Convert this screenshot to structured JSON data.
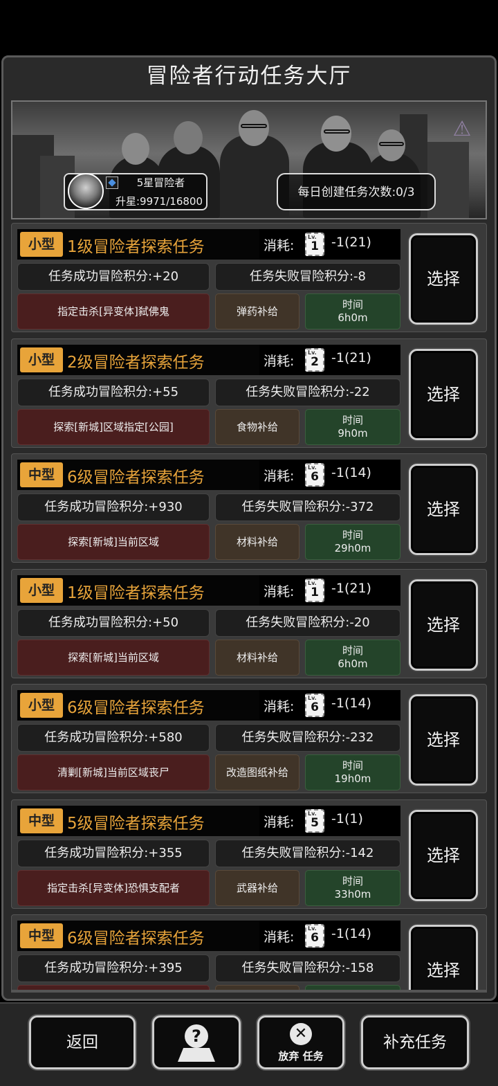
{
  "title": "冒险者行动任务大厅",
  "player": {
    "rank_label": "5星冒险者",
    "progress_label": "升星:9971/16800"
  },
  "daily": {
    "label": "每日创建任务次数:0/3"
  },
  "cost_label": "消耗:",
  "time_label": "时间",
  "select_label": "选择",
  "missions": [
    {
      "size": "小型",
      "title": "1级冒险者探索任务",
      "card_level": "1",
      "cost": "-1(21)",
      "success": "任务成功冒险积分:+20",
      "fail": "任务失败冒险积分:-8",
      "target": "指定击杀[异变体]弑佛鬼",
      "reward": "弹药补给",
      "time": "6h0m"
    },
    {
      "size": "小型",
      "title": "2级冒险者探索任务",
      "card_level": "2",
      "cost": "-1(21)",
      "success": "任务成功冒险积分:+55",
      "fail": "任务失败冒险积分:-22",
      "target": "探索[新城]区域指定[公园]",
      "reward": "食物补给",
      "time": "9h0m"
    },
    {
      "size": "中型",
      "title": "6级冒险者探索任务",
      "card_level": "6",
      "cost": "-1(14)",
      "success": "任务成功冒险积分:+930",
      "fail": "任务失败冒险积分:-372",
      "target": "探索[新城]当前区域",
      "reward": "材料补给",
      "time": "29h0m"
    },
    {
      "size": "小型",
      "title": "1级冒险者探索任务",
      "card_level": "1",
      "cost": "-1(21)",
      "success": "任务成功冒险积分:+50",
      "fail": "任务失败冒险积分:-20",
      "target": "探索[新城]当前区域",
      "reward": "材料补给",
      "time": "6h0m"
    },
    {
      "size": "小型",
      "title": "6级冒险者探索任务",
      "card_level": "6",
      "cost": "-1(14)",
      "success": "任务成功冒险积分:+580",
      "fail": "任务失败冒险积分:-232",
      "target": "清剿[新城]当前区域丧尸",
      "reward": "改造图纸补给",
      "time": "19h0m"
    },
    {
      "size": "中型",
      "title": "5级冒险者探索任务",
      "card_level": "5",
      "cost": "-1(1)",
      "success": "任务成功冒险积分:+355",
      "fail": "任务失败冒险积分:-142",
      "target": "指定击杀[异变体]恐惧支配者",
      "reward": "武器补给",
      "time": "33h0m"
    },
    {
      "size": "中型",
      "title": "6级冒险者探索任务",
      "card_level": "6",
      "cost": "-1(14)",
      "success": "任务成功冒险积分:+395",
      "fail": "任务失败冒险积分:-158",
      "target": "",
      "reward": "",
      "time": ""
    }
  ],
  "bottom": {
    "back_label": "返回",
    "help_icon": "question-map-icon",
    "abandon_label": "放弃 任务",
    "abandon_icon": "close-circle-icon",
    "replenish_label": "补充任务"
  },
  "colors": {
    "accent": "#e8a43a",
    "target_bg": "#4a1e1e",
    "reward_bg": "#403428",
    "time_bg": "#24442a"
  }
}
